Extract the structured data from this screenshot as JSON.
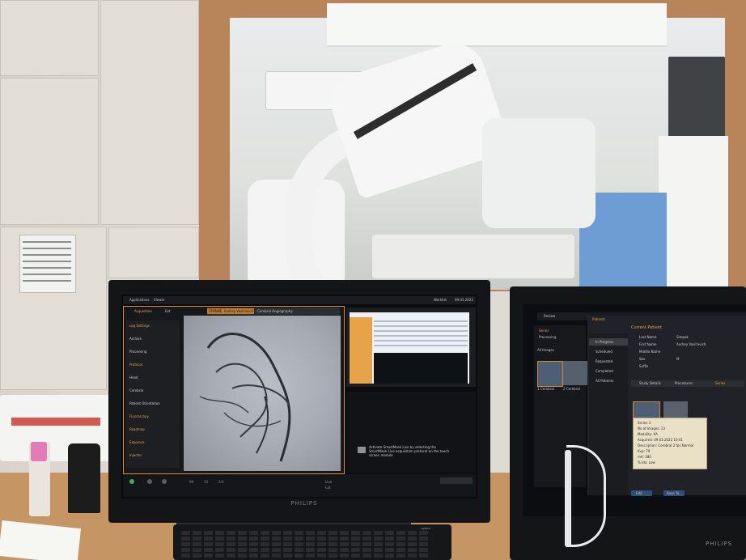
{
  "main_monitor": {
    "brand": "PHILIPS",
    "top_bar": {
      "left_items": [
        "Applications",
        "Viewer"
      ],
      "right_items": [
        "Worklist",
        "09.03.2022"
      ]
    },
    "left_panel": {
      "tab_main": "Acquisition",
      "tab_secondary": "Ext",
      "patient_tab": "SPBNNE, Andrey Vasil'evich",
      "study_tab": "Cerebral Angiography",
      "menu": [
        {
          "label": "Log Settings",
          "heading": true
        },
        {
          "label": "Archive",
          "heading": false
        },
        {
          "label": "Processing",
          "heading": false
        },
        {
          "label": "Protocol",
          "heading": true
        },
        {
          "label": "Head",
          "heading": false
        },
        {
          "label": "Cerebral",
          "heading": false
        },
        {
          "label": "Patient Orientation",
          "heading": false
        },
        {
          "label": "Fluoroscopy",
          "heading": true
        },
        {
          "label": "Roadmap",
          "heading": true
        },
        {
          "label": "Exposure",
          "heading": true
        },
        {
          "label": "Injector",
          "heading": true
        }
      ]
    },
    "hint_text": "Activate SmartMask Live by selecting the SmartMask Live acquisition protocol on the touch screen module",
    "bottom_bar": {
      "left_labels": [
        "00",
        "13",
        "2:0"
      ],
      "right_labels": [
        "Live",
        "Lat"
      ]
    }
  },
  "second_monitor": {
    "brand": "PHILIPS",
    "header": "Review",
    "series_label": "Series",
    "series_sub": "Processing",
    "all_images": "All Images",
    "thumbs": [
      "1 Cerebral",
      "2 Cerebral"
    ],
    "patients_title": "Patients",
    "current_patient_title": "Current Patient",
    "side_items": [
      "In Progress",
      "Scheduled",
      "Requested",
      "Completed",
      "All Patients"
    ],
    "details": [
      {
        "label": "Last Name",
        "value": "Simpak"
      },
      {
        "label": "First Name",
        "value": "Andrey Vasil'evich"
      },
      {
        "label": "Middle Name",
        "value": ""
      },
      {
        "label": "Sex",
        "value": "M"
      },
      {
        "label": "Suffix",
        "value": ""
      }
    ],
    "study_tabs": [
      "Study Details",
      "Procedures",
      "Series"
    ],
    "popup_lines": [
      "Series 3",
      "No of Images: 23",
      "Modality: XA",
      "Acquired: 09.03.2022 10:41",
      "Description: Cerebral 2 fps Normal",
      "Kvp: 79",
      "mA: 380",
      "% Idx: Low"
    ],
    "buttons": [
      "Edit",
      "Save To..."
    ]
  },
  "keyboard": {
    "brand": "logitech"
  }
}
